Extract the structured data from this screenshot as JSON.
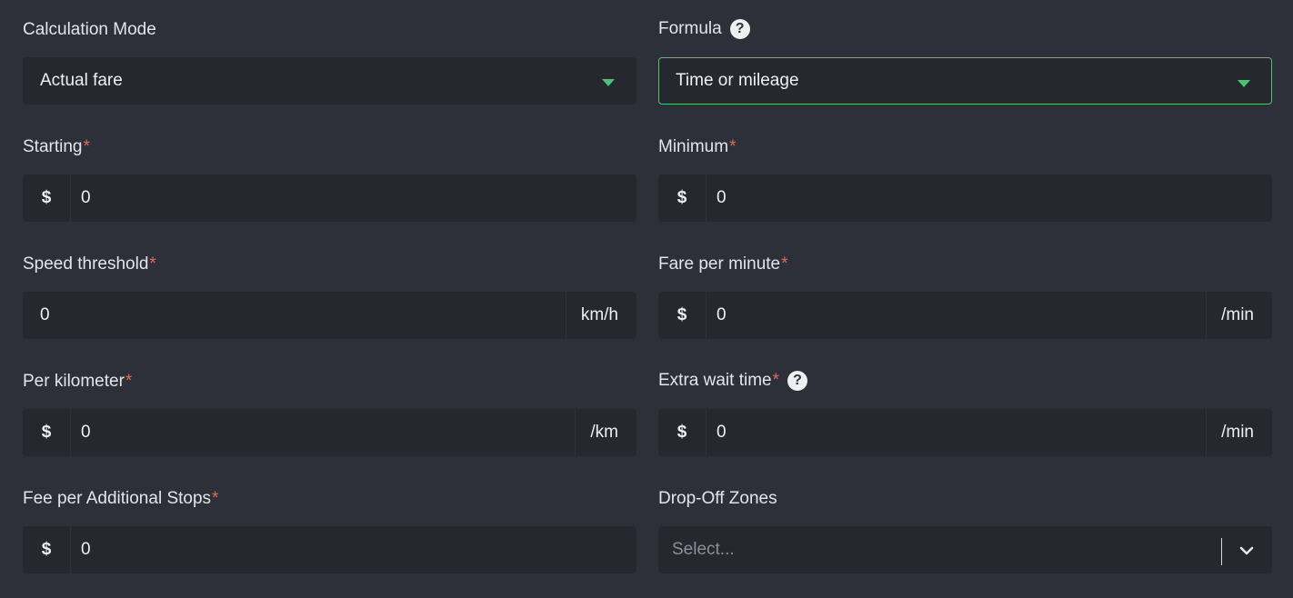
{
  "calc_mode": {
    "label": "Calculation Mode",
    "value": "Actual fare"
  },
  "formula": {
    "label": "Formula",
    "value": "Time or mileage",
    "help_icon": "question-circle-icon"
  },
  "starting": {
    "label": "Starting",
    "required": "*",
    "prefix": "$",
    "value": "0"
  },
  "minimum": {
    "label": "Minimum",
    "required": "*",
    "prefix": "$",
    "value": "0"
  },
  "speed_threshold": {
    "label": "Speed threshold",
    "required": "*",
    "value": "0",
    "suffix": "km/h"
  },
  "fare_per_minute": {
    "label": "Fare per minute",
    "required": "*",
    "prefix": "$",
    "value": "0",
    "suffix": "/min"
  },
  "per_kilometer": {
    "label": "Per kilometer",
    "required": "*",
    "prefix": "$",
    "value": "0",
    "suffix": "/km"
  },
  "extra_wait_time": {
    "label": "Extra wait time",
    "required": "*",
    "prefix": "$",
    "value": "0",
    "suffix": "/min",
    "help_icon": "question-circle-icon"
  },
  "fee_additional_stops": {
    "label": "Fee per Additional Stops",
    "required": "*",
    "prefix": "$",
    "value": "0"
  },
  "dropoff_zones": {
    "label": "Drop-Off Zones",
    "placeholder": "Select..."
  },
  "colors": {
    "background": "#2d3039",
    "field": "#262830",
    "accent": "#4fc177",
    "required": "#e06a5a"
  }
}
